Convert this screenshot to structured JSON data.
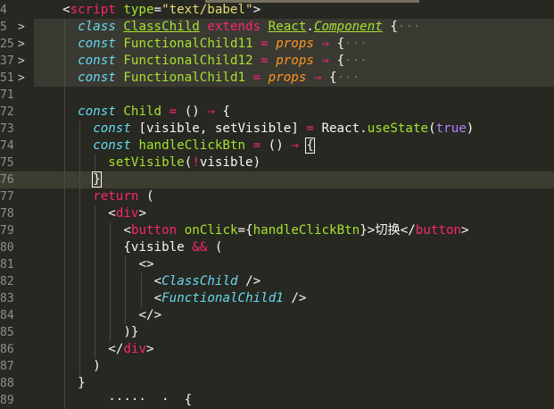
{
  "editor": {
    "language": "JavaScript (Babel)",
    "lines": [
      {
        "num": "4",
        "fold": "",
        "indent": 1,
        "tokens": [
          [
            "t-punc",
            "<"
          ],
          [
            "t-tag",
            "script"
          ],
          [
            "t-plain",
            " "
          ],
          [
            "t-attr",
            "type"
          ],
          [
            "t-punc",
            "="
          ],
          [
            "t-str",
            "\"text/babel\""
          ],
          [
            "t-punc",
            ">"
          ]
        ]
      },
      {
        "num": "5",
        "fold": ">",
        "indent": 2,
        "folded": true,
        "tokens": [
          [
            "t-kw",
            "class"
          ],
          [
            "t-plain",
            " "
          ],
          [
            "t-cls",
            "ClassChild"
          ],
          [
            "t-plain",
            " "
          ],
          [
            "t-op",
            "extends"
          ],
          [
            "t-plain",
            " "
          ],
          [
            "t-cls",
            "React"
          ],
          [
            "t-plain",
            "."
          ],
          [
            "t-ext",
            "Component"
          ],
          [
            "t-plain",
            " "
          ],
          [
            "t-plain",
            "{"
          ],
          [
            "t-fold",
            "···"
          ]
        ]
      },
      {
        "num": "25",
        "fold": ">",
        "indent": 2,
        "folded": true,
        "tokens": [
          [
            "t-kw",
            "const"
          ],
          [
            "t-plain",
            " "
          ],
          [
            "t-fn",
            "FunctionalChild11"
          ],
          [
            "t-plain",
            " "
          ],
          [
            "t-op",
            "="
          ],
          [
            "t-plain",
            " "
          ],
          [
            "t-param",
            "props"
          ],
          [
            "t-plain",
            " "
          ],
          [
            "t-op",
            "⇒"
          ],
          [
            "t-plain",
            " {"
          ],
          [
            "t-fold",
            "···"
          ]
        ]
      },
      {
        "num": "37",
        "fold": ">",
        "indent": 2,
        "folded": true,
        "tokens": [
          [
            "t-kw",
            "const"
          ],
          [
            "t-plain",
            " "
          ],
          [
            "t-fn",
            "FunctionalChild12"
          ],
          [
            "t-plain",
            " "
          ],
          [
            "t-op",
            "="
          ],
          [
            "t-plain",
            " "
          ],
          [
            "t-param",
            "props"
          ],
          [
            "t-plain",
            " "
          ],
          [
            "t-op",
            "⇒"
          ],
          [
            "t-plain",
            " {"
          ],
          [
            "t-fold",
            "···"
          ]
        ]
      },
      {
        "num": "51",
        "fold": ">",
        "indent": 2,
        "folded": true,
        "tokens": [
          [
            "t-kw",
            "const"
          ],
          [
            "t-plain",
            " "
          ],
          [
            "t-fn",
            "FunctionalChild1"
          ],
          [
            "t-plain",
            " "
          ],
          [
            "t-op",
            "="
          ],
          [
            "t-plain",
            " "
          ],
          [
            "t-param",
            "props"
          ],
          [
            "t-plain",
            " "
          ],
          [
            "t-op",
            "⇒"
          ],
          [
            "t-plain",
            " {"
          ],
          [
            "t-fold",
            "···"
          ]
        ]
      },
      {
        "num": "71",
        "fold": "",
        "indent": 2,
        "tokens": []
      },
      {
        "num": "72",
        "fold": "",
        "indent": 2,
        "tokens": [
          [
            "t-kw",
            "const"
          ],
          [
            "t-plain",
            " "
          ],
          [
            "t-fn",
            "Child"
          ],
          [
            "t-plain",
            " "
          ],
          [
            "t-op",
            "="
          ],
          [
            "t-plain",
            " () "
          ],
          [
            "t-op",
            "⇒"
          ],
          [
            "t-plain",
            " {"
          ]
        ]
      },
      {
        "num": "73",
        "fold": "",
        "indent": 3,
        "tokens": [
          [
            "t-kw",
            "const"
          ],
          [
            "t-plain",
            " [visible, setVisible] "
          ],
          [
            "t-op",
            "="
          ],
          [
            "t-plain",
            " React."
          ],
          [
            "t-fn",
            "useState"
          ],
          [
            "t-plain",
            "("
          ],
          [
            "t-bool",
            "true"
          ],
          [
            "t-plain",
            ")"
          ]
        ]
      },
      {
        "num": "74",
        "fold": "",
        "indent": 3,
        "tokens": [
          [
            "t-kw",
            "const"
          ],
          [
            "t-plain",
            " "
          ],
          [
            "t-fn",
            "handleClickBtn"
          ],
          [
            "t-plain",
            " "
          ],
          [
            "t-op",
            "="
          ],
          [
            "t-plain",
            " () "
          ],
          [
            "t-op",
            "⇒"
          ],
          [
            "t-plain",
            " "
          ],
          [
            "t-bracket-hl",
            "{"
          ]
        ]
      },
      {
        "num": "75",
        "fold": "",
        "indent": 4,
        "tokens": [
          [
            "t-fn",
            "setVisible"
          ],
          [
            "t-plain",
            "("
          ],
          [
            "t-op",
            "!"
          ],
          [
            "t-plain",
            "visible)"
          ]
        ]
      },
      {
        "num": "76",
        "fold": "",
        "indent": 3,
        "current": true,
        "tokens": [
          [
            "t-bracket-hl",
            "}"
          ],
          [
            "t-caret",
            ""
          ]
        ]
      },
      {
        "num": "77",
        "fold": "",
        "indent": 3,
        "tokens": [
          [
            "t-op",
            "return"
          ],
          [
            "t-plain",
            " ("
          ]
        ]
      },
      {
        "num": "78",
        "fold": "",
        "indent": 4,
        "tokens": [
          [
            "t-punc",
            "<"
          ],
          [
            "t-tag",
            "div"
          ],
          [
            "t-punc",
            ">"
          ]
        ]
      },
      {
        "num": "79",
        "fold": "",
        "indent": 5,
        "tokens": [
          [
            "t-punc",
            "<"
          ],
          [
            "t-tag",
            "button"
          ],
          [
            "t-plain",
            " "
          ],
          [
            "t-attr",
            "onClick"
          ],
          [
            "t-punc",
            "="
          ],
          [
            "t-plain",
            "{"
          ],
          [
            "t-fn",
            "handleClickBtn"
          ],
          [
            "t-plain",
            "}"
          ],
          [
            "t-punc",
            ">"
          ],
          [
            "t-plain",
            "切换"
          ],
          [
            "t-punc",
            "</"
          ],
          [
            "t-tag",
            "button"
          ],
          [
            "t-punc",
            ">"
          ]
        ]
      },
      {
        "num": "80",
        "fold": "",
        "indent": 5,
        "tokens": [
          [
            "t-plain",
            "{visible "
          ],
          [
            "t-op",
            "&&"
          ],
          [
            "t-plain",
            " ("
          ]
        ]
      },
      {
        "num": "81",
        "fold": "",
        "indent": 6,
        "tokens": [
          [
            "t-punc",
            "<>"
          ]
        ]
      },
      {
        "num": "82",
        "fold": "",
        "indent": 7,
        "tokens": [
          [
            "t-punc",
            "<"
          ],
          [
            "t-comp",
            "ClassChild"
          ],
          [
            "t-plain",
            " "
          ],
          [
            "t-punc",
            "/>"
          ]
        ]
      },
      {
        "num": "83",
        "fold": "",
        "indent": 7,
        "tokens": [
          [
            "t-punc",
            "<"
          ],
          [
            "t-comp",
            "FunctionalChild1"
          ],
          [
            "t-plain",
            " "
          ],
          [
            "t-punc",
            "/>"
          ]
        ]
      },
      {
        "num": "84",
        "fold": "",
        "indent": 6,
        "tokens": [
          [
            "t-punc",
            "</>"
          ]
        ]
      },
      {
        "num": "85",
        "fold": "",
        "indent": 5,
        "tokens": [
          [
            "t-plain",
            ")}"
          ]
        ]
      },
      {
        "num": "86",
        "fold": "",
        "indent": 4,
        "tokens": [
          [
            "t-punc",
            "</"
          ],
          [
            "t-tag",
            "div"
          ],
          [
            "t-punc",
            ">"
          ]
        ]
      },
      {
        "num": "87",
        "fold": "",
        "indent": 3,
        "tokens": [
          [
            "t-plain",
            ")"
          ]
        ]
      },
      {
        "num": "88",
        "fold": "",
        "indent": 2,
        "tokens": [
          [
            "t-plain",
            "}"
          ]
        ]
      },
      {
        "num": "89",
        "fold": "",
        "indent": 2,
        "tokens": [
          [
            "t-plain",
            "    ·····  ·  {"
          ]
        ]
      }
    ]
  }
}
